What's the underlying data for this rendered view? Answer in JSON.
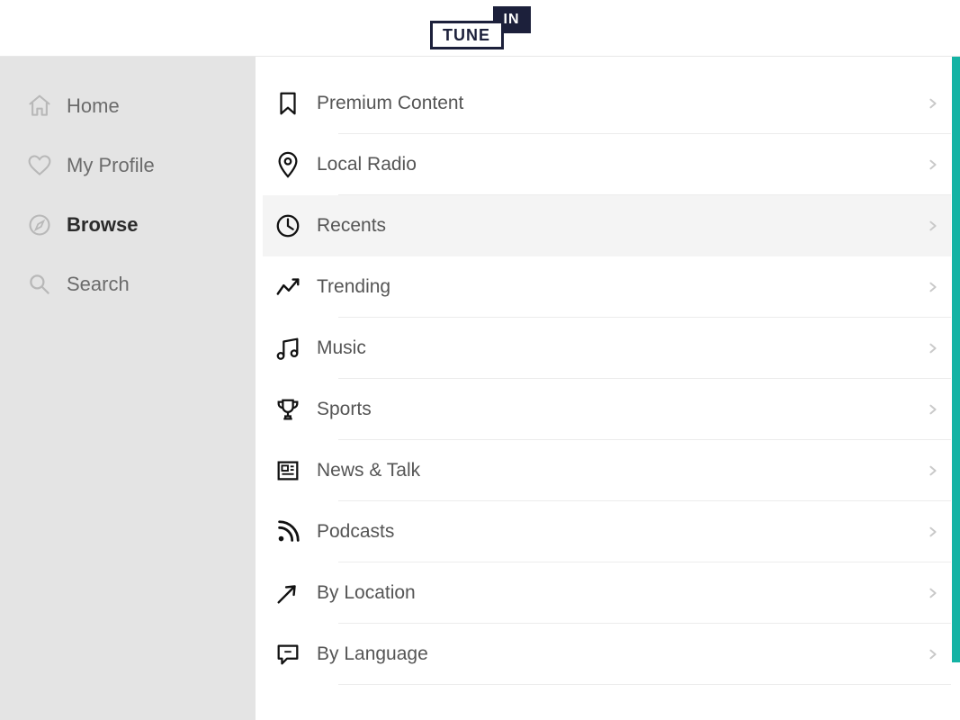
{
  "brand": {
    "tune": "TUNE",
    "in": "IN"
  },
  "sidebar": {
    "items": [
      {
        "label": "Home",
        "icon": "home",
        "active": false
      },
      {
        "label": "My Profile",
        "icon": "heart",
        "active": false
      },
      {
        "label": "Browse",
        "icon": "compass",
        "active": true
      },
      {
        "label": "Search",
        "icon": "search",
        "active": false
      }
    ]
  },
  "browse": {
    "categories": [
      {
        "label": "Premium Content",
        "icon": "bookmark",
        "hover": false
      },
      {
        "label": "Local Radio",
        "icon": "pin",
        "hover": false
      },
      {
        "label": "Recents",
        "icon": "clock",
        "hover": true
      },
      {
        "label": "Trending",
        "icon": "trend",
        "hover": false
      },
      {
        "label": "Music",
        "icon": "music",
        "hover": false
      },
      {
        "label": "Sports",
        "icon": "trophy",
        "hover": false
      },
      {
        "label": "News & Talk",
        "icon": "news",
        "hover": false
      },
      {
        "label": "Podcasts",
        "icon": "rss",
        "hover": false
      },
      {
        "label": "By Location",
        "icon": "arrow",
        "hover": false
      },
      {
        "label": "By Language",
        "icon": "chat",
        "hover": false
      }
    ]
  },
  "colors": {
    "accent": "#14b3a4",
    "brandDark": "#1c203b"
  }
}
